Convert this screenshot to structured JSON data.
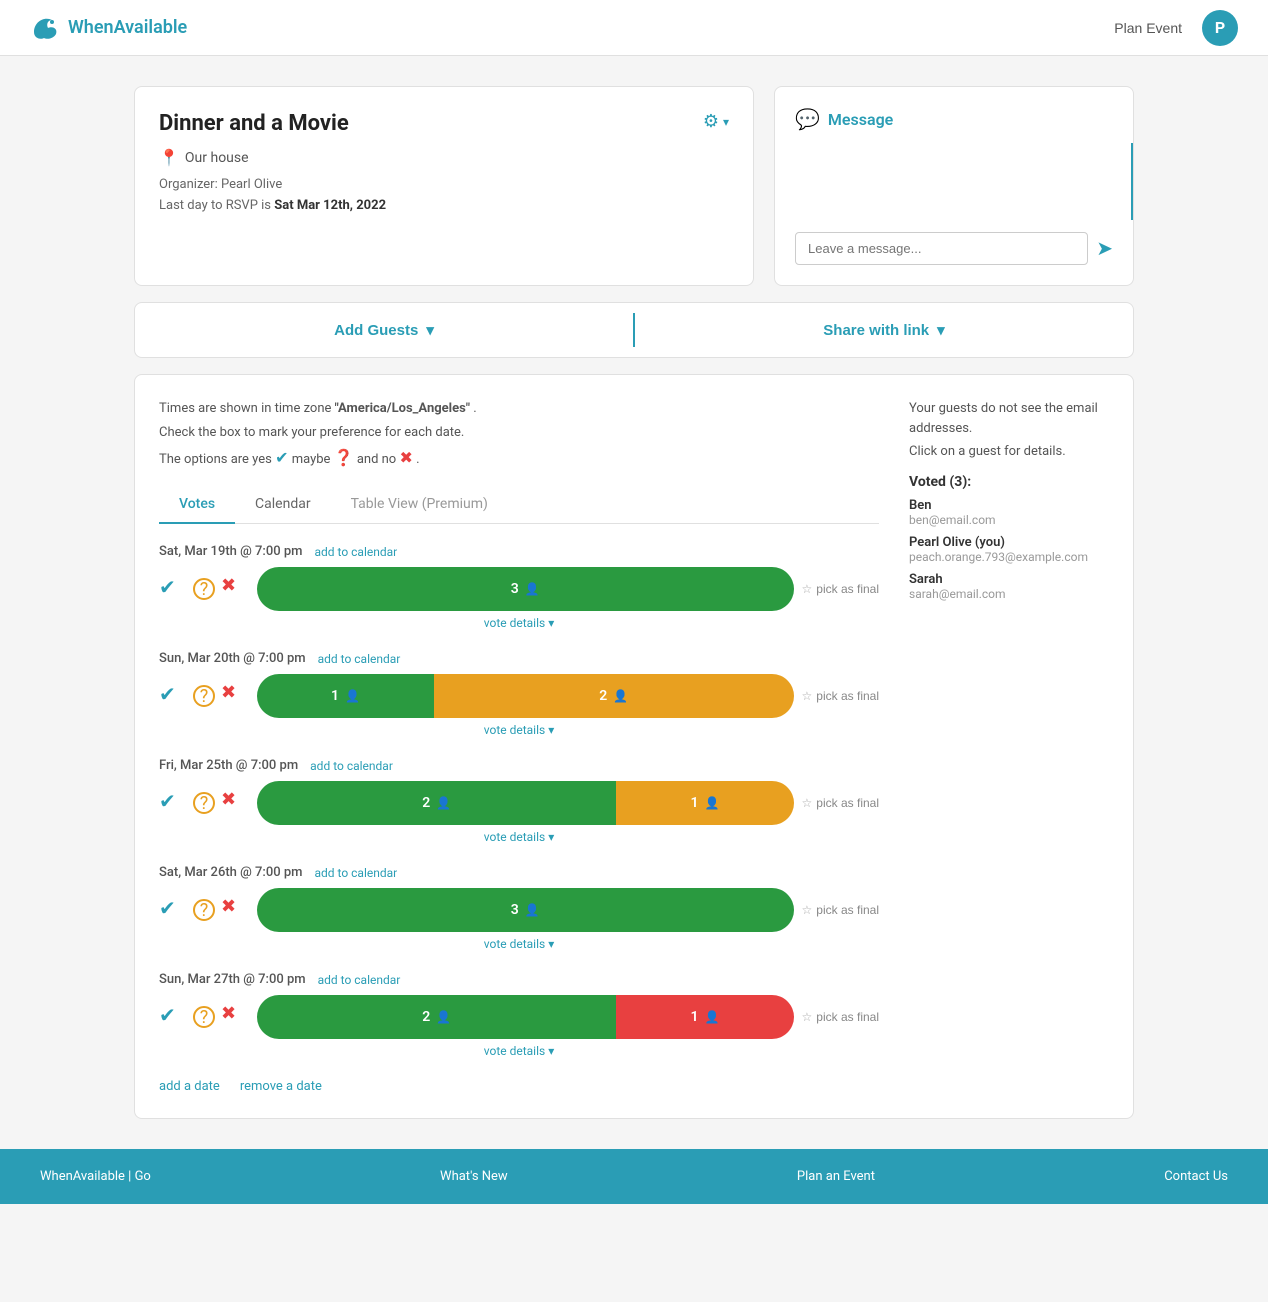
{
  "header": {
    "logo_text": "WhenAvailable",
    "plan_event_label": "Plan Event",
    "avatar_letter": "P"
  },
  "event": {
    "title": "Dinner and a Movie",
    "location": "Our house",
    "organizer": "Organizer: Pearl Olive",
    "rsvp_prefix": "Last day to RSVP is ",
    "rsvp_date": "Sat Mar 12th, 2022"
  },
  "message": {
    "title": "Message",
    "input_placeholder": "Leave a message..."
  },
  "actions": {
    "add_guests_label": "Add Guests",
    "share_link_label": "Share with link"
  },
  "votes_section": {
    "info1": "Times are shown in time zone ",
    "timezone": "\"America/Los_Angeles\"",
    "info1_end": ".",
    "info2": "Check the box to mark your preference for each date.",
    "info3_prefix": "The options are yes ",
    "info3_maybe": " maybe ",
    "info3_and": " and no ",
    "sidebar_info1": "Your guests do not see the email addresses.",
    "sidebar_info2": "Click on a guest for details.",
    "voted_title": "Voted (3):",
    "guests": [
      {
        "name": "Ben",
        "email": "ben@email.com"
      },
      {
        "name": "Pearl Olive (you)",
        "email": "peach.orange.793@example.com"
      },
      {
        "name": "Sarah",
        "email": "sarah@email.com"
      }
    ]
  },
  "tabs": [
    {
      "label": "Votes",
      "active": true
    },
    {
      "label": "Calendar",
      "active": false
    },
    {
      "label": "Table View (Premium)",
      "active": false,
      "premium": true
    }
  ],
  "dates": [
    {
      "label": "Sat, Mar 19th @ 7:00 pm",
      "add_cal": "add to calendar",
      "green": 3,
      "yellow": 0,
      "red": 0,
      "green_pct": 100,
      "yellow_pct": 0,
      "red_pct": 0,
      "pick_final": "pick as final",
      "vote_details": "vote details"
    },
    {
      "label": "Sun, Mar 20th @ 7:00 pm",
      "add_cal": "add to calendar",
      "green": 1,
      "yellow": 2,
      "red": 0,
      "green_pct": 33,
      "yellow_pct": 67,
      "red_pct": 0,
      "pick_final": "pick as final",
      "vote_details": "vote details"
    },
    {
      "label": "Fri, Mar 25th @ 7:00 pm",
      "add_cal": "add to calendar",
      "green": 2,
      "yellow": 1,
      "red": 0,
      "green_pct": 67,
      "yellow_pct": 33,
      "red_pct": 0,
      "pick_final": "pick as final",
      "vote_details": "vote details"
    },
    {
      "label": "Sat, Mar 26th @ 7:00 pm",
      "add_cal": "add to calendar",
      "green": 3,
      "yellow": 0,
      "red": 0,
      "green_pct": 100,
      "yellow_pct": 0,
      "red_pct": 0,
      "pick_final": "pick as final",
      "vote_details": "vote details"
    },
    {
      "label": "Sun, Mar 27th @ 7:00 pm",
      "add_cal": "add to calendar",
      "green": 2,
      "yellow": 0,
      "red": 1,
      "green_pct": 67,
      "yellow_pct": 0,
      "red_pct": 33,
      "pick_final": "pick as final",
      "vote_details": "vote details"
    }
  ],
  "bottom_links": {
    "add_date": "add a date",
    "remove_date": "remove a date"
  },
  "footer": {
    "col1": [
      "WhenAvailable | Go",
      ""
    ],
    "col2": [
      "What's New",
      ""
    ],
    "col3": [
      "Plan an Event",
      ""
    ],
    "col4": [
      "Contact Us",
      ""
    ]
  }
}
